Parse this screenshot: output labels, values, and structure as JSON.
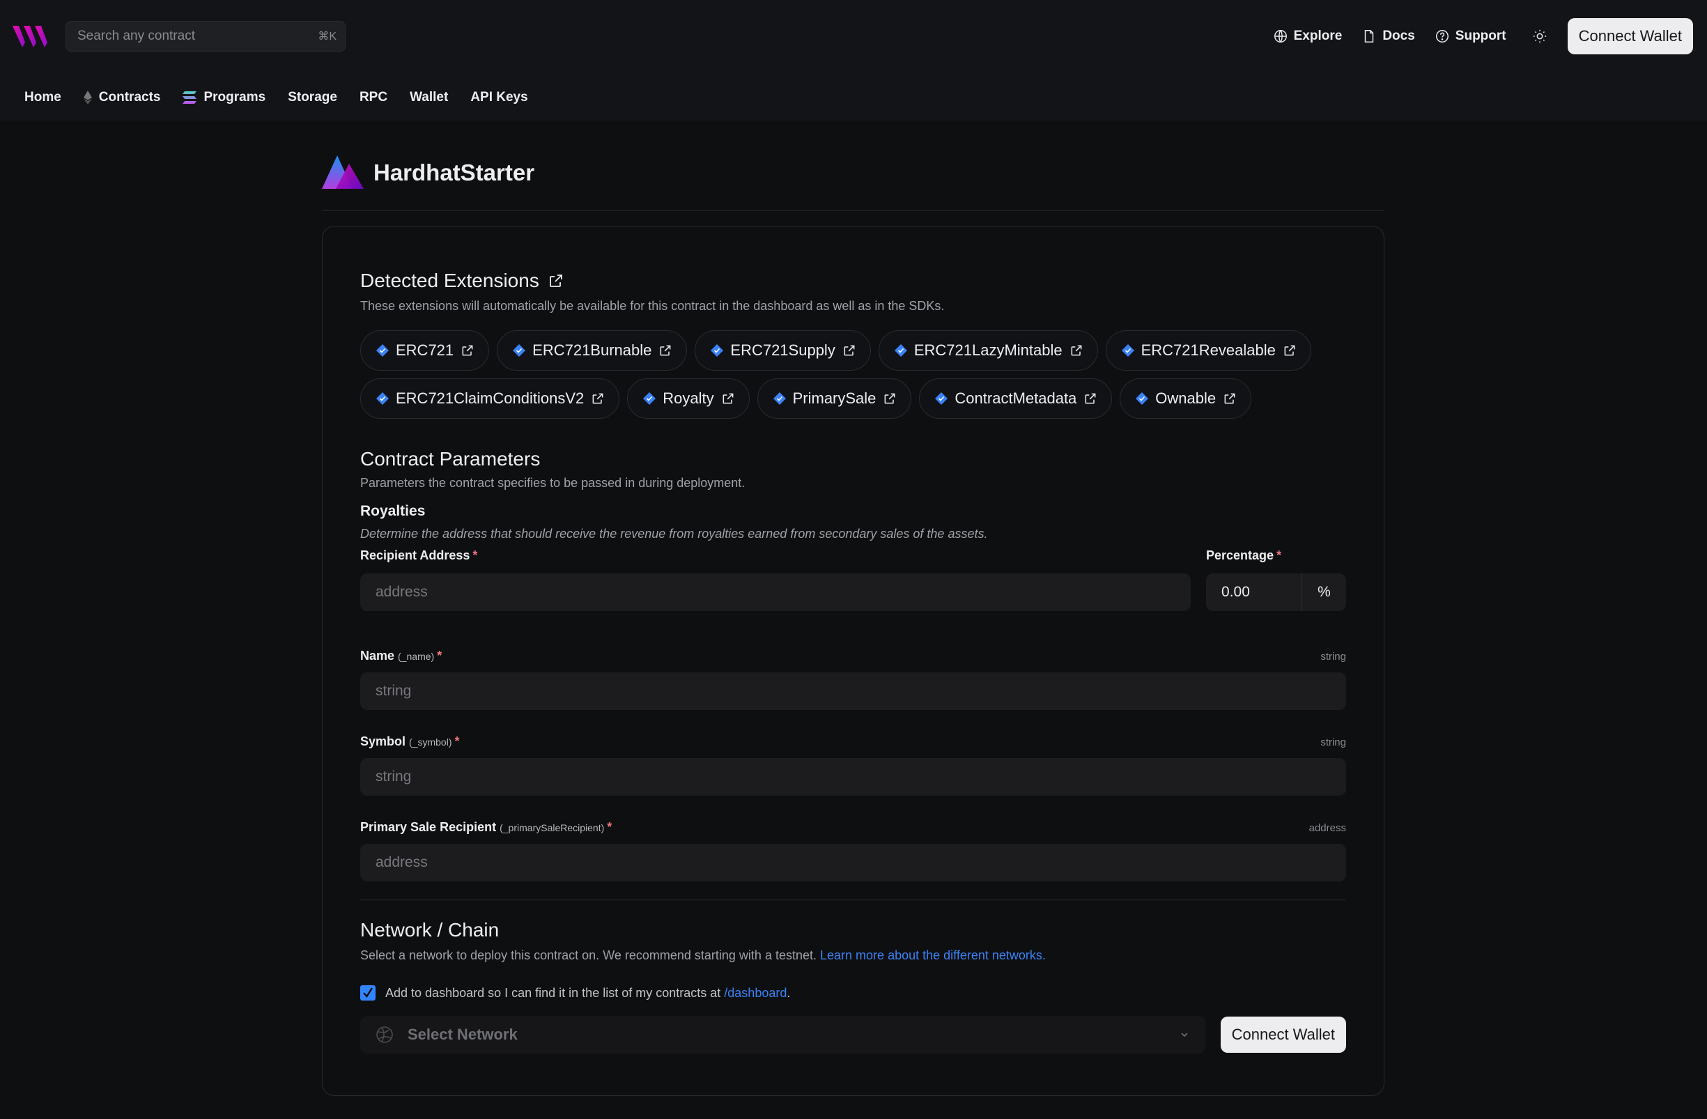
{
  "header": {
    "search_placeholder": "Search any contract",
    "search_shortcut": "⌘K",
    "links": [
      {
        "label": "Explore",
        "icon": "globe-icon"
      },
      {
        "label": "Docs",
        "icon": "document-icon"
      },
      {
        "label": "Support",
        "icon": "help-circle-icon"
      }
    ],
    "theme_icon": "sun-icon",
    "connect_wallet_label": "Connect Wallet"
  },
  "nav": {
    "items": [
      {
        "label": "Home"
      },
      {
        "label": "Contracts",
        "icon": "ethereum-icon"
      },
      {
        "label": "Programs",
        "icon": "solana-icon"
      },
      {
        "label": "Storage"
      },
      {
        "label": "RPC"
      },
      {
        "label": "Wallet"
      },
      {
        "label": "API Keys"
      }
    ]
  },
  "page": {
    "title": "HardhatStarter",
    "title_icon": "hardhat-logo-icon"
  },
  "extensions": {
    "heading": "Detected Extensions",
    "description": "These extensions will automatically be available for this contract in the dashboard as well as in the SDKs.",
    "items": [
      "ERC721",
      "ERC721Burnable",
      "ERC721Supply",
      "ERC721LazyMintable",
      "ERC721Revealable",
      "ERC721ClaimConditionsV2",
      "Royalty",
      "PrimarySale",
      "ContractMetadata",
      "Ownable"
    ]
  },
  "parameters": {
    "heading": "Contract Parameters",
    "description": "Parameters the contract specifies to be passed in during deployment.",
    "royalties": {
      "heading": "Royalties",
      "description": "Determine the address that should receive the revenue from royalties earned from secondary sales of the assets.",
      "recipient_label": "Recipient Address",
      "recipient_placeholder": "address",
      "percentage_label": "Percentage",
      "percentage_value": "0.00",
      "percentage_suffix": "%"
    },
    "fields": [
      {
        "label": "Name",
        "param": "(_name)",
        "type": "string",
        "placeholder": "string"
      },
      {
        "label": "Symbol",
        "param": "(_symbol)",
        "type": "string",
        "placeholder": "string"
      },
      {
        "label": "Primary Sale Recipient",
        "param": "(_primarySaleRecipient)",
        "type": "address",
        "placeholder": "address"
      }
    ],
    "required_mark": "*"
  },
  "network": {
    "heading": "Network / Chain",
    "description": "Select a network to deploy this contract on. We recommend starting with a testnet.",
    "learn_more_link": "Learn more about the different networks.",
    "checkbox_checked": true,
    "checkbox_text": "Add to dashboard so I can find it in the list of my contracts at",
    "dashboard_link": "/dashboard",
    "checkbox_text_end": ".",
    "select_placeholder": "Select Network",
    "connect_wallet_label": "Connect Wallet"
  },
  "colors": {
    "accent_blue": "#3b82f6",
    "required_red": "#f0787c",
    "background": "#0e0f11",
    "header_bg": "#131418"
  }
}
